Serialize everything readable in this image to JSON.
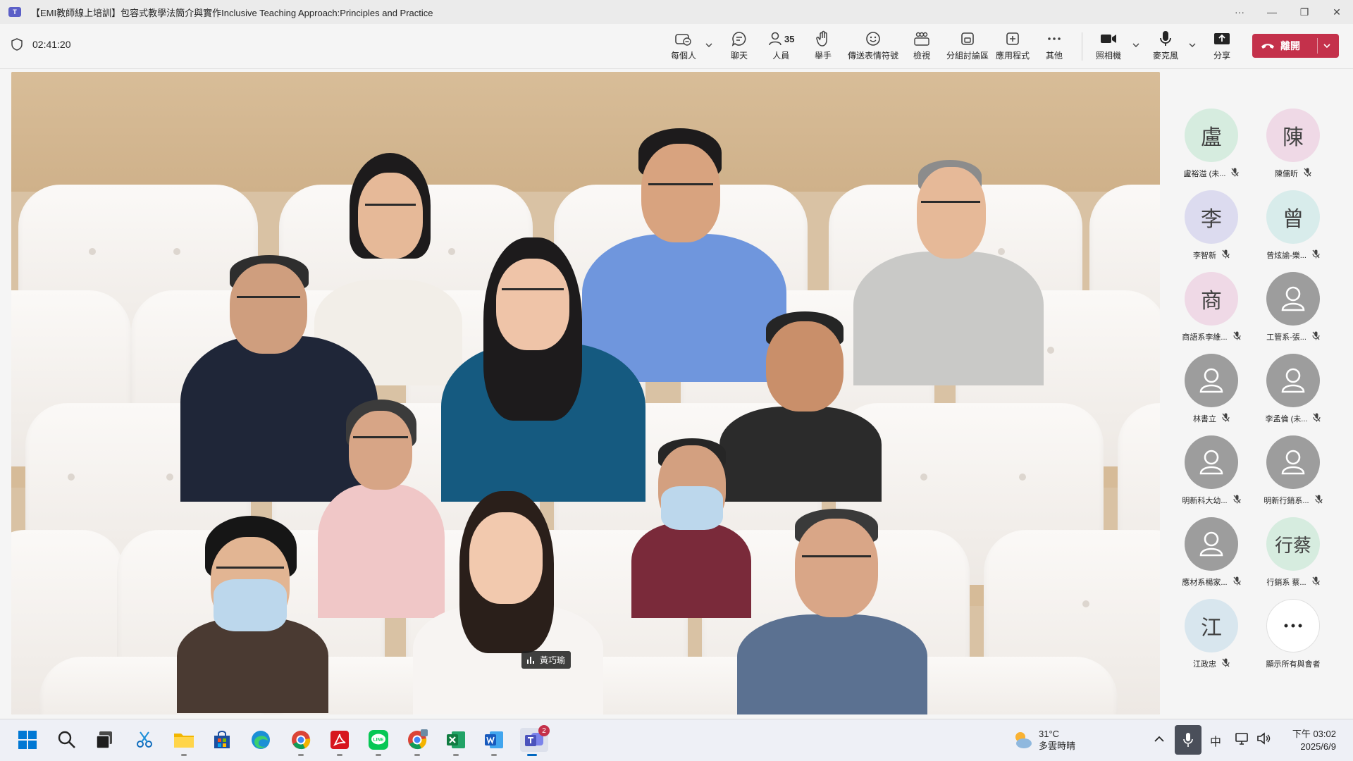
{
  "window": {
    "title": "【EMI教師線上培訓】包容式教學法簡介與實作Inclusive Teaching Approach:Principles and Practice",
    "app_icon": "teams-logo-icon",
    "controls": [
      "more-icon",
      "minimize-icon",
      "restore-icon",
      "close-icon"
    ]
  },
  "meeting": {
    "elapsed": "02:41:20",
    "people_count": "35",
    "toolbar": {
      "view": "每個人",
      "chat": "聊天",
      "people": "人員",
      "raise_hand": "舉手",
      "react": "傳送表情符號",
      "view_mode": "檢視",
      "breakout": "分組討論區",
      "apps": "應用程式",
      "more": "其他",
      "camera": "照相機",
      "mic": "麥克風",
      "share": "分享",
      "leave": "離開"
    },
    "speaker_tag": "黃巧瑜"
  },
  "participants": [
    {
      "initial": "盧",
      "name": "盧裕溢 (未...",
      "bg": "#d6ecdf"
    },
    {
      "initial": "陳",
      "name": "陳儒昕",
      "bg": "#efd9e6"
    },
    {
      "initial": "李",
      "name": "李智新",
      "bg": "#dcdbef"
    },
    {
      "initial": "曾",
      "name": "曾炫諭-樂...",
      "bg": "#d8eceb"
    },
    {
      "initial": "商",
      "name": "商語系李維...",
      "bg": "#efd9e6"
    },
    {
      "initial": "",
      "name": "工管系-張...",
      "bg": "#9d9d9d"
    },
    {
      "initial": "",
      "name": "林書立",
      "bg": "#9d9d9d"
    },
    {
      "initial": "",
      "name": "李孟倫 (未...",
      "bg": "#9d9d9d"
    },
    {
      "initial": "",
      "name": "明新科大幼...",
      "bg": "#9d9d9d"
    },
    {
      "initial": "",
      "name": "明新行銷系...",
      "bg": "#9d9d9d"
    },
    {
      "initial": "",
      "name": "應材系楊家...",
      "bg": "#9d9d9d"
    },
    {
      "initial": "行蔡",
      "name": "行銷系 蔡...",
      "bg": "#d6ecdf"
    },
    {
      "initial": "江",
      "name": "江政忠",
      "bg": "#d8e6ee"
    },
    {
      "initial": "",
      "name": "顯示所有與會者",
      "bg": "#ffffff"
    }
  ],
  "taskbar": {
    "apps": [
      "start-icon",
      "search-icon",
      "task-view-icon",
      "snipping-tool-icon",
      "file-explorer-icon",
      "store-icon",
      "edge-icon",
      "chrome-icon",
      "acrobat-icon",
      "line-icon",
      "chrome-profile-icon",
      "excel-icon",
      "word-icon",
      "teams-icon"
    ],
    "teams_badge": "2",
    "weather_temp": "31°C",
    "weather_desc": "多雲時晴",
    "ime": "中",
    "time": "下午 03:02",
    "date": "2025/6/9"
  }
}
